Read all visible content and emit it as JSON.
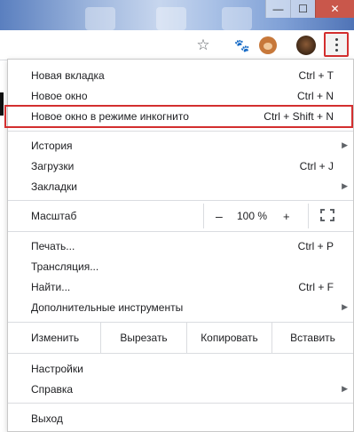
{
  "window_controls": {
    "minimize": "—",
    "maximize": "☐",
    "close": "✕"
  },
  "toolbar": {
    "bookmark_icon": "star-icon",
    "extension1_icon": "paw-icon",
    "extension2_icon": "monkey-icon",
    "profile_icon": "profile-avatar",
    "menu_icon": "kebab-menu-icon"
  },
  "menu": {
    "new_tab": {
      "label": "Новая вкладка",
      "shortcut": "Ctrl + T"
    },
    "new_window": {
      "label": "Новое окно",
      "shortcut": "Ctrl + N"
    },
    "incognito": {
      "label": "Новое окно в режиме инкогнито",
      "shortcut": "Ctrl + Shift + N"
    },
    "history": {
      "label": "История"
    },
    "downloads": {
      "label": "Загрузки",
      "shortcut": "Ctrl + J"
    },
    "bookmarks": {
      "label": "Закладки"
    },
    "zoom": {
      "label": "Масштаб",
      "minus": "–",
      "value": "100 %",
      "plus": "+"
    },
    "print": {
      "label": "Печать...",
      "shortcut": "Ctrl + P"
    },
    "cast": {
      "label": "Трансляция..."
    },
    "find": {
      "label": "Найти...",
      "shortcut": "Ctrl + F"
    },
    "more_tools": {
      "label": "Дополнительные инструменты"
    },
    "edit": {
      "label": "Изменить",
      "cut": "Вырезать",
      "copy": "Копировать",
      "paste": "Вставить"
    },
    "settings": {
      "label": "Настройки"
    },
    "help": {
      "label": "Справка"
    },
    "exit": {
      "label": "Выход"
    },
    "submenu_arrow": "▶"
  },
  "colors": {
    "highlight": "#d32f2f"
  }
}
